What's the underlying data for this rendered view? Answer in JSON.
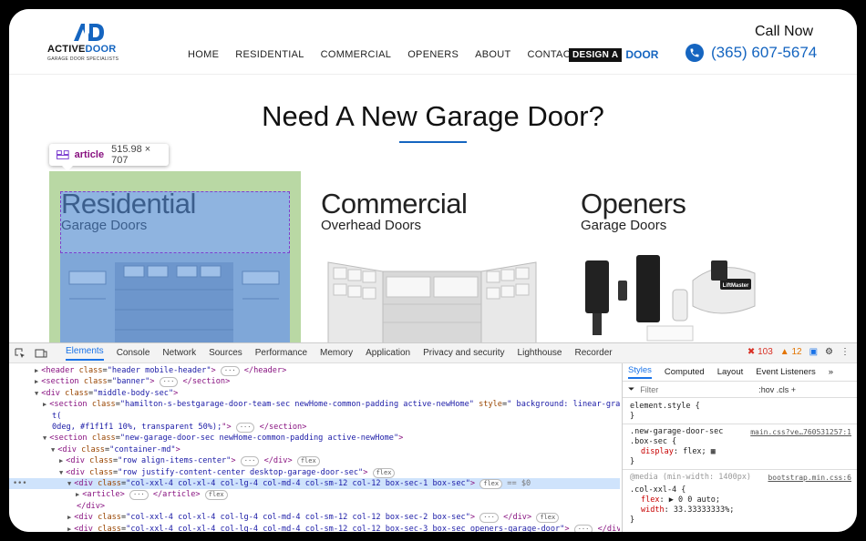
{
  "logo": {
    "brand_first": "ACTIVE",
    "brand_second": "DOOR",
    "tagline": "GARAGE DOOR SPECIALISTS"
  },
  "nav": [
    "HOME",
    "RESIDENTIAL",
    "COMMERCIAL",
    "OPENERS",
    "ABOUT",
    "CONTACT"
  ],
  "design_button": {
    "dark": "DESIGN A",
    "blue": "DOOR"
  },
  "call": {
    "label": "Call Now",
    "phone": "(365) 607-5674"
  },
  "hero": {
    "title": "Need A New Garage Door?"
  },
  "tooltip": {
    "tag": "article",
    "dims": "515.98 × 707"
  },
  "cards": [
    {
      "title": "Residential",
      "subtitle": "Garage Doors"
    },
    {
      "title": "Commercial",
      "subtitle": "Overhead Doors"
    },
    {
      "title": "Openers",
      "subtitle": "Garage Doors"
    }
  ],
  "opener_brand": "LiftMaster",
  "devtools": {
    "tabs": [
      "Elements",
      "Console",
      "Network",
      "Sources",
      "Performance",
      "Memory",
      "Application",
      "Privacy and security",
      "Lighthouse",
      "Recorder"
    ],
    "errors": "103",
    "warnings": "12",
    "dom_lines": [
      {
        "indent": 2,
        "arrow": "▶",
        "html": "<span class='tg'>&lt;header</span> <span class='at'>class</span>=<span class='av'>\"header mobile-header\"</span><span class='tg'>&gt;</span> <span class='badge'>···</span> <span class='tg'>&lt;/header&gt;</span>"
      },
      {
        "indent": 2,
        "arrow": "▶",
        "html": "<span class='tg'>&lt;section</span> <span class='at'>class</span>=<span class='av'>\"banner\"</span><span class='tg'>&gt;</span> <span class='badge'>···</span> <span class='tg'>&lt;/section&gt;</span>"
      },
      {
        "indent": 2,
        "arrow": "▼",
        "html": "<span class='tg'>&lt;div</span> <span class='at'>class</span>=<span class='av'>\"middle-body-sec\"</span><span class='tg'>&gt;</span>"
      },
      {
        "indent": 3,
        "arrow": "▶",
        "html": "<span class='tg'>&lt;section</span> <span class='at'>class</span>=<span class='av'>\"hamilton-s-bestgarage-door-team-sec newHome-common-padding active-newHome\"</span> <span class='at'>style</span>=<span class='av'>\" background: linear-gradien</span>"
      },
      {
        "indent": 3,
        "arrow": "",
        "html": "<span class='av'>t(</span>"
      },
      {
        "indent": 3,
        "arrow": "",
        "html": "<span class='av'>0deg, #f1f1f1 10%, transparent 50%);</span><span class='tg'>\"&gt;</span> <span class='badge'>···</span> <span class='tg'>&lt;/section&gt;</span>"
      },
      {
        "indent": 3,
        "arrow": "▼",
        "html": "<span class='tg'>&lt;section</span> <span class='at'>class</span>=<span class='av'>\"new-garage-door-sec newHome-common-padding active-newHome\"</span><span class='tg'>&gt;</span>"
      },
      {
        "indent": 4,
        "arrow": "▼",
        "html": "<span class='tg'>&lt;div</span> <span class='at'>class</span>=<span class='av'>\"container-md\"</span><span class='tg'>&gt;</span>"
      },
      {
        "indent": 5,
        "arrow": "▶",
        "html": "<span class='tg'>&lt;div</span> <span class='at'>class</span>=<span class='av'>\"row align-items-center\"</span><span class='tg'>&gt;</span> <span class='badge'>···</span> <span class='tg'>&lt;/div&gt;</span> <span class='badge'>flex</span>"
      },
      {
        "indent": 5,
        "arrow": "▼",
        "html": "<span class='tg'>&lt;div</span> <span class='at'>class</span>=<span class='av'>\"row justify-content-center desktop-garage-door-sec\"</span><span class='tg'>&gt;</span> <span class='badge'>flex</span>"
      },
      {
        "indent": 6,
        "arrow": "▼",
        "html": "<span class='tg'>&lt;div</span> <span class='at'>class</span>=<span class='av'>\"col-xxl-4 col-xl-4 col-lg-4 col-md-4 col-sm-12 col-12 box-sec-1 box-sec\"</span><span class='tg'>&gt;</span> <span class='badge'>flex</span> <span class='dollar'>== $0</span>",
        "selected": true
      },
      {
        "indent": 7,
        "arrow": "▶",
        "html": "<span class='tg'>&lt;article&gt;</span> <span class='badge'>···</span> <span class='tg'>&lt;/article&gt;</span> <span class='badge'>flex</span>"
      },
      {
        "indent": 6,
        "arrow": "",
        "html": "<span class='tg'>&lt;/div&gt;</span>"
      },
      {
        "indent": 6,
        "arrow": "▶",
        "html": "<span class='tg'>&lt;div</span> <span class='at'>class</span>=<span class='av'>\"col-xxl-4 col-xl-4 col-lg-4 col-md-4 col-sm-12 col-12 box-sec-2 box-sec\"</span><span class='tg'>&gt;</span> <span class='badge'>···</span> <span class='tg'>&lt;/div&gt;</span> <span class='badge'>flex</span>"
      },
      {
        "indent": 6,
        "arrow": "▶",
        "html": "<span class='tg'>&lt;div</span> <span class='at'>class</span>=<span class='av'>\"col-xxl-4 col-xl-4 col-lg-4 col-md-4 col-sm-12 col-12 box-sec-3 box-sec openers-garage-door\"</span><span class='tg'>&gt;</span> <span class='badge'>···</span> <span class='tg'>&lt;/div&gt;</span> <span class='badge'>flex</span>"
      }
    ],
    "styles_tabs": [
      "Styles",
      "Computed",
      "Layout",
      "Event Listeners"
    ],
    "filter_placeholder": "Filter",
    "filter_tools": ":hov  .cls  +",
    "element_style": "element.style {",
    "close_brace": "}",
    "rule1": {
      "selector": ".new-garage-door-sec",
      "selector2": ".box-sec {",
      "source": "main.css?ve…760531257:1",
      "prop": "display",
      "value": "flex;"
    },
    "media": {
      "query": "@media (min-width: 1400px)",
      "source": "bootstrap.min.css:6"
    },
    "rule2": {
      "selector": ".col-xxl-4 {",
      "prop1": "flex",
      "val1": "▶ 0 0 auto;",
      "prop2": "width",
      "val2": "33.33333333%;"
    }
  }
}
